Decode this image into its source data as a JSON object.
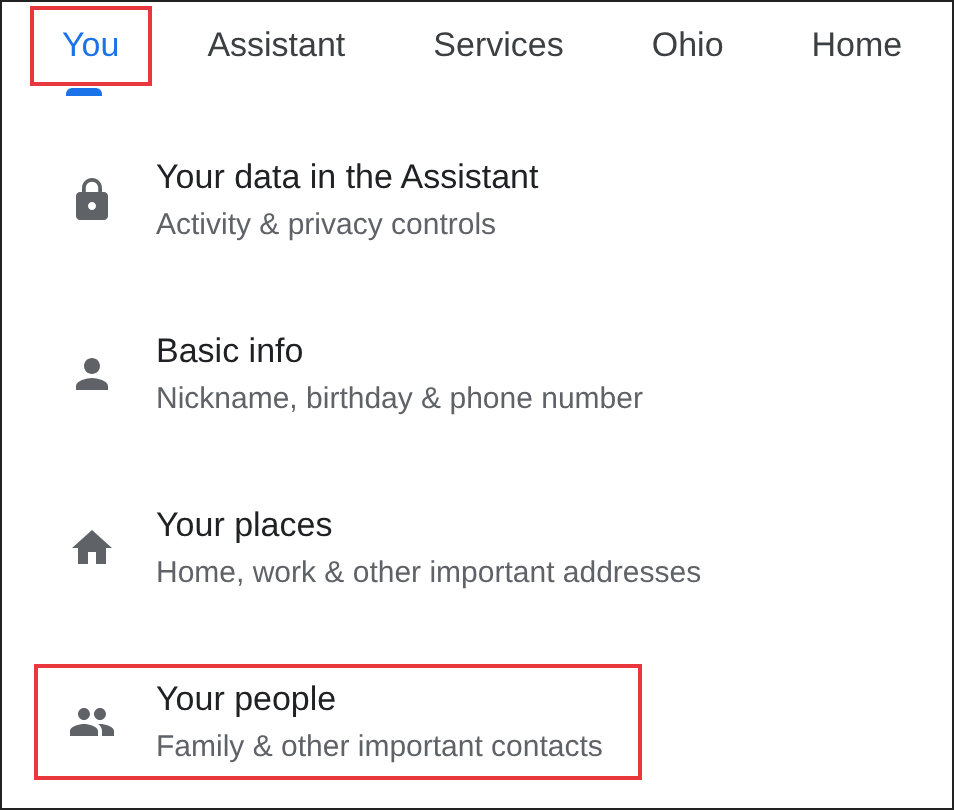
{
  "tabs": [
    {
      "label": "You",
      "selected": true,
      "highlighted": true
    },
    {
      "label": "Assistant",
      "selected": false,
      "highlighted": false
    },
    {
      "label": "Services",
      "selected": false,
      "highlighted": false
    },
    {
      "label": "Ohio",
      "selected": false,
      "highlighted": false
    },
    {
      "label": "Home",
      "selected": false,
      "highlighted": false
    }
  ],
  "items": [
    {
      "kind": "lock",
      "title": "Your data in the Assistant",
      "subtitle": "Activity & privacy controls",
      "highlighted": false
    },
    {
      "kind": "person",
      "title": "Basic info",
      "subtitle": "Nickname, birthday & phone number",
      "highlighted": false
    },
    {
      "kind": "home",
      "title": "Your places",
      "subtitle": "Home, work & other important addresses",
      "highlighted": false
    },
    {
      "kind": "people",
      "title": "Your people",
      "subtitle": "Family & other important contacts",
      "highlighted": true
    }
  ]
}
